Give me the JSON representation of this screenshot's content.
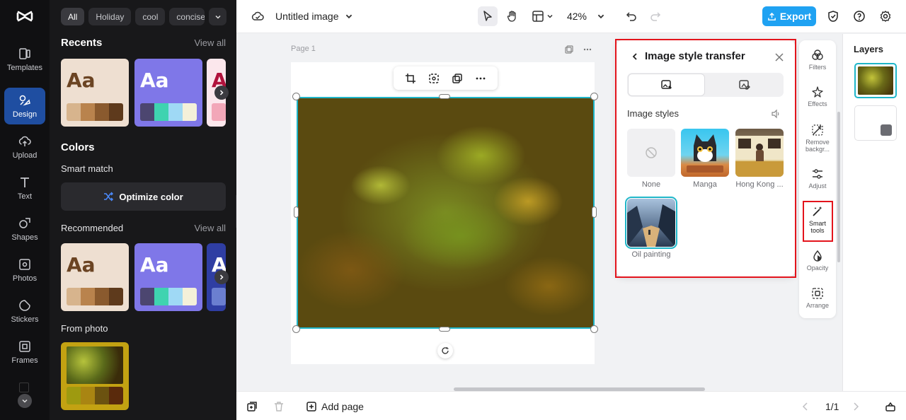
{
  "rail": {
    "items": [
      {
        "label": "Templates",
        "icon": "templates-icon"
      },
      {
        "label": "Design",
        "icon": "design-icon",
        "active": true
      },
      {
        "label": "Upload",
        "icon": "upload-icon"
      },
      {
        "label": "Text",
        "icon": "text-icon"
      },
      {
        "label": "Shapes",
        "icon": "shapes-icon"
      },
      {
        "label": "Photos",
        "icon": "photos-icon"
      },
      {
        "label": "Stickers",
        "icon": "stickers-icon"
      },
      {
        "label": "Frames",
        "icon": "frames-icon"
      }
    ]
  },
  "panel": {
    "chips": [
      "All",
      "Holiday",
      "cool",
      "concise"
    ],
    "recents_title": "Recents",
    "recents_view_all": "View all",
    "colors_title": "Colors",
    "smart_match": "Smart match",
    "optimize_label": "Optimize color",
    "recommended_title": "Recommended",
    "recommended_view_all": "View all",
    "from_photo_title": "From photo",
    "card_text": "Aa",
    "card_text_partial": "A"
  },
  "topbar": {
    "doc_title": "Untitled image",
    "zoom": "42%",
    "export_label": "Export"
  },
  "canvas": {
    "page_label": "Page 1"
  },
  "style_transfer": {
    "title": "Image style transfer",
    "section_label": "Image styles",
    "styles": [
      {
        "name": "None"
      },
      {
        "name": "Manga"
      },
      {
        "name": "Hong Kong ..."
      },
      {
        "name": "Oil painting",
        "selected": true
      }
    ]
  },
  "tools": [
    {
      "label": "Filters",
      "icon": "filters-icon"
    },
    {
      "label": "Effects",
      "icon": "effects-icon"
    },
    {
      "label": "Remove backgr...",
      "icon": "remove-background-icon"
    },
    {
      "label": "Adjust",
      "icon": "adjust-icon"
    },
    {
      "label": "Smart tools",
      "icon": "smart-tools-icon"
    },
    {
      "label": "Opacity",
      "icon": "opacity-icon"
    },
    {
      "label": "Arrange",
      "icon": "arrange-icon"
    }
  ],
  "layers": {
    "title": "Layers"
  },
  "bottombar": {
    "add_page": "Add page",
    "page_counter": "1/1"
  },
  "colors": {
    "accent": "#1fa2f2",
    "selection": "#1fb6c9",
    "highlight": "#e3141c",
    "rail_active": "#1f4ea1"
  }
}
